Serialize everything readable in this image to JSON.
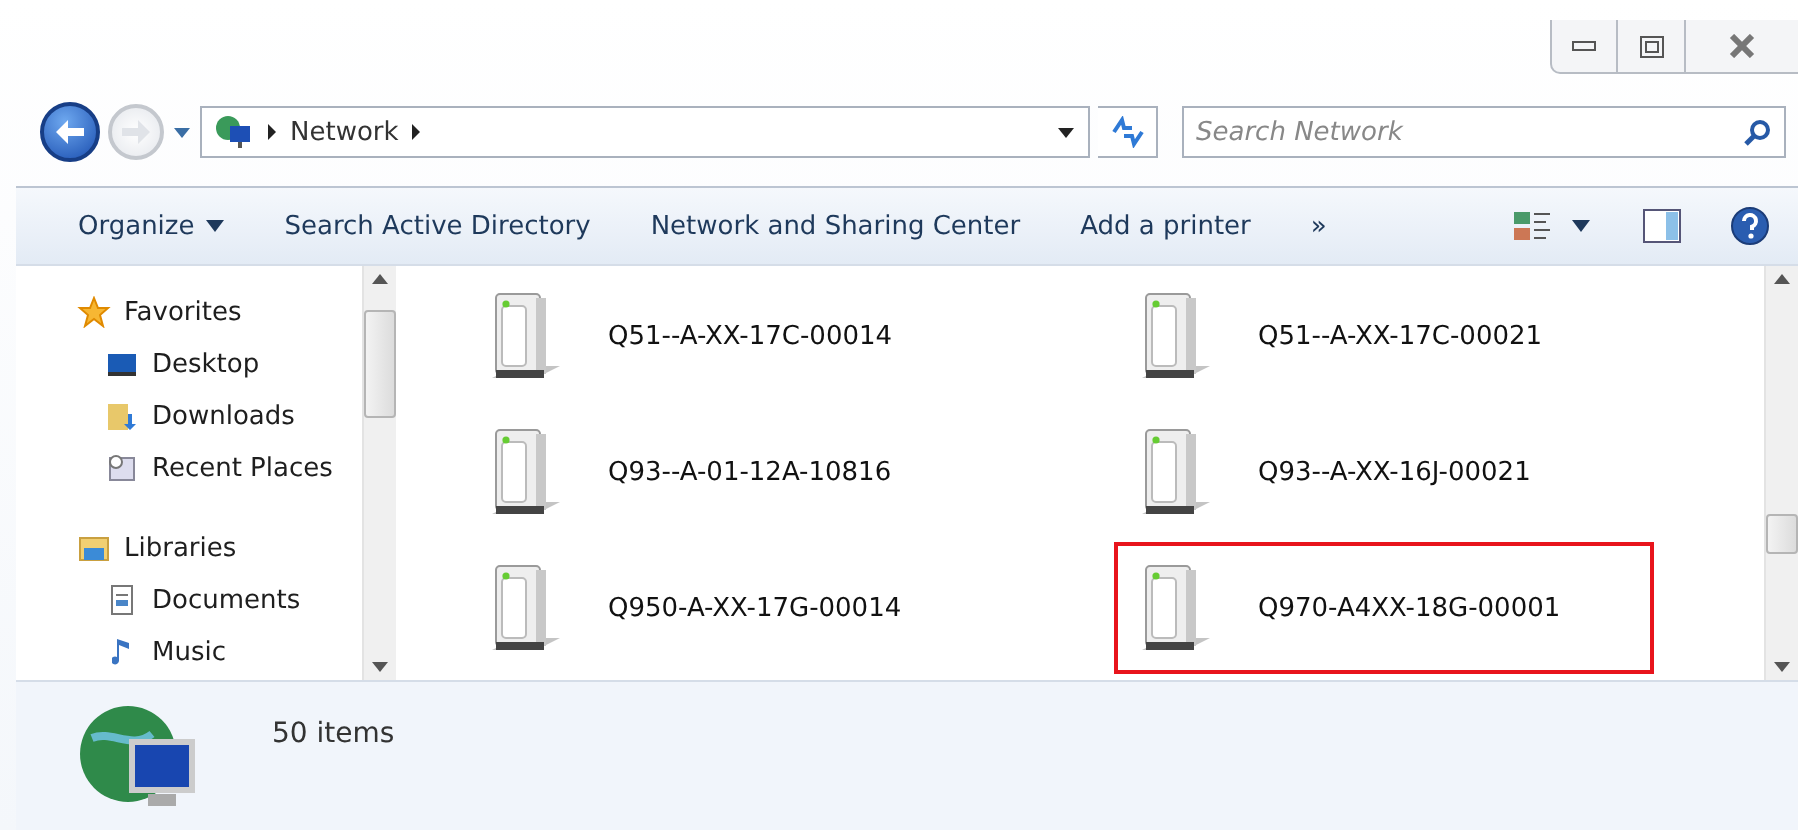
{
  "address": {
    "crumbs": [
      "Network"
    ]
  },
  "search": {
    "placeholder": "Search Network"
  },
  "toolbar": {
    "items": [
      "Organize",
      "Search Active Directory",
      "Network and Sharing Center",
      "Add a printer"
    ],
    "more": "»"
  },
  "sidebar": {
    "groups": [
      {
        "label": "Favorites",
        "kind": "favorites",
        "children": [
          {
            "label": "Desktop",
            "kind": "desktop"
          },
          {
            "label": "Downloads",
            "kind": "downloads"
          },
          {
            "label": "Recent Places",
            "kind": "recent"
          }
        ]
      },
      {
        "label": "Libraries",
        "kind": "libraries",
        "children": [
          {
            "label": "Documents",
            "kind": "documents"
          },
          {
            "label": "Music",
            "kind": "music"
          }
        ]
      }
    ]
  },
  "items": [
    {
      "name": "Q51--A-XX-17C-00014",
      "highlighted": false
    },
    {
      "name": "Q51--A-XX-17C-00021",
      "highlighted": false
    },
    {
      "name": "Q93--A-01-12A-10816",
      "highlighted": false
    },
    {
      "name": "Q93--A-XX-16J-00021",
      "highlighted": false
    },
    {
      "name": "Q950-A-XX-17G-00014",
      "highlighted": false
    },
    {
      "name": "Q970-A4XX-18G-00001",
      "highlighted": true
    }
  ],
  "status_bar": {
    "count": "50 items"
  }
}
